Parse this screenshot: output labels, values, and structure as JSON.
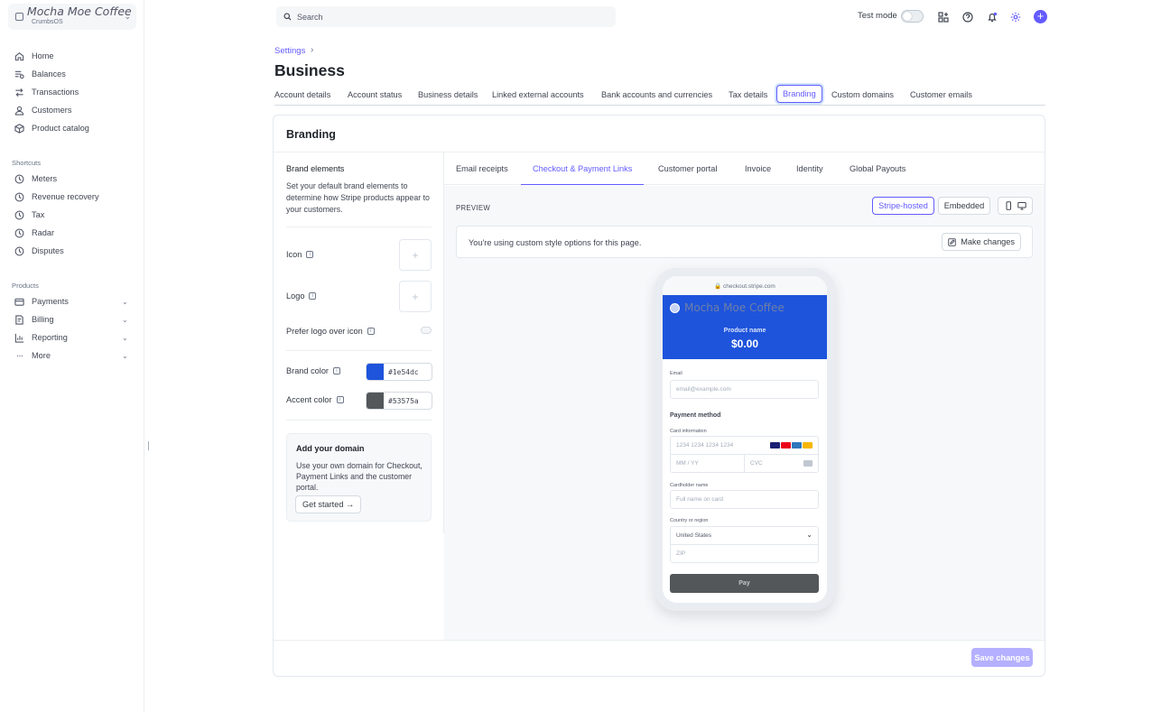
{
  "account": {
    "name": "Mocha Moe Coffee",
    "sub": "CrumbsOS"
  },
  "sidebar": {
    "main": [
      {
        "label": "Home",
        "icon": "home-icon"
      },
      {
        "label": "Balances",
        "icon": "balances-icon"
      },
      {
        "label": "Transactions",
        "icon": "transactions-icon"
      },
      {
        "label": "Customers",
        "icon": "customers-icon"
      },
      {
        "label": "Product catalog",
        "icon": "product-catalog-icon"
      }
    ],
    "shortcuts_title": "Shortcuts",
    "shortcuts": [
      {
        "label": "Meters",
        "icon": "clock-icon"
      },
      {
        "label": "Revenue recovery",
        "icon": "clock-icon"
      },
      {
        "label": "Tax",
        "icon": "clock-icon"
      },
      {
        "label": "Radar",
        "icon": "clock-icon"
      },
      {
        "label": "Disputes",
        "icon": "clock-icon"
      }
    ],
    "products_title": "Products",
    "products": [
      {
        "label": "Payments",
        "icon": "payments-icon"
      },
      {
        "label": "Billing",
        "icon": "billing-icon"
      },
      {
        "label": "Reporting",
        "icon": "reporting-icon"
      },
      {
        "label": "More",
        "icon": "more-icon"
      }
    ]
  },
  "topbar": {
    "search_placeholder": "Search",
    "test_mode_label": "Test mode",
    "test_mode_on": false,
    "plus": "+"
  },
  "header": {
    "breadcrumb": "Settings",
    "breadcrumb_sep": "›",
    "title": "Business",
    "tabs": [
      "Account details",
      "Account status",
      "Business details",
      "Linked external accounts",
      "Bank accounts and currencies",
      "Tax details",
      "Branding",
      "Custom domains",
      "Customer emails"
    ],
    "active_tab": "Branding"
  },
  "card": {
    "title": "Branding",
    "save_label": "Save changes",
    "left": {
      "title": "Brand elements",
      "description": "Set your default brand elements to determine how Stripe products appear to your customers.",
      "icon_label": "Icon",
      "logo_label": "Logo",
      "upload_plus": "+",
      "prefer_logo_label": "Prefer logo over icon",
      "brand_color_label": "Brand color",
      "brand_color": "#1e54dc",
      "accent_color_label": "Accent color",
      "accent_color": "#53575a",
      "info": "i",
      "domain": {
        "title": "Add your domain",
        "description": "Use your own domain for Checkout, Payment Links and the customer portal.",
        "button": "Get started →"
      }
    },
    "right": {
      "tabs": [
        "Email receipts",
        "Checkout & Payment Links",
        "Customer portal",
        "Invoice",
        "Identity",
        "Global Payouts"
      ],
      "active_tab": "Checkout & Payment Links",
      "preview_label": "PREVIEW",
      "hosted_label": "Stripe-hosted",
      "embedded_label": "Embedded",
      "notice": "You're using custom style options for this page.",
      "make_changes": "Make changes"
    },
    "checkout": {
      "url": "🔒 checkout.stripe.com",
      "brand": "Mocha Moe Coffee",
      "product_name": "Product name",
      "price": "$0.00",
      "email_label": "Email",
      "email_placeholder": "email@example.com",
      "payment_method": "Payment method",
      "card_info_label": "Card information",
      "card_number_placeholder": "1234 1234 1234 1234",
      "expiry_placeholder": "MM / YY",
      "cvc_placeholder": "CVC",
      "cardholder_label": "Cardholder name",
      "cardholder_placeholder": "Full name on card",
      "country_label": "Country or region",
      "country_value": "United States",
      "zip_placeholder": "ZIP",
      "pay_label": "Pay",
      "card_brand_colors": [
        "#1a1f71",
        "#eb001b",
        "#2e77bb",
        "#f7b600"
      ]
    }
  }
}
